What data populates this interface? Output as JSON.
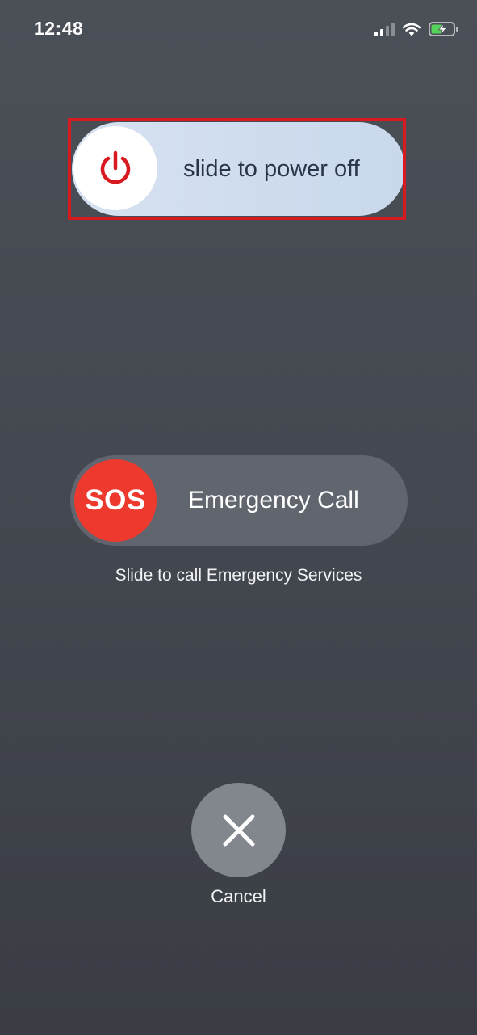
{
  "status_bar": {
    "time": "12:48",
    "icons": [
      "cellular-signal-icon",
      "wifi-icon",
      "battery-charging-icon"
    ]
  },
  "power_slider": {
    "label": "slide to power off",
    "icon": "power-icon",
    "icon_color": "#d71920",
    "highlight_color": "#d71920"
  },
  "sos_slider": {
    "knob_text": "SOS",
    "label": "Emergency Call",
    "caption": "Slide to call Emergency Services",
    "knob_color": "#ee3a2e"
  },
  "cancel": {
    "label": "Cancel",
    "icon": "close-icon"
  }
}
